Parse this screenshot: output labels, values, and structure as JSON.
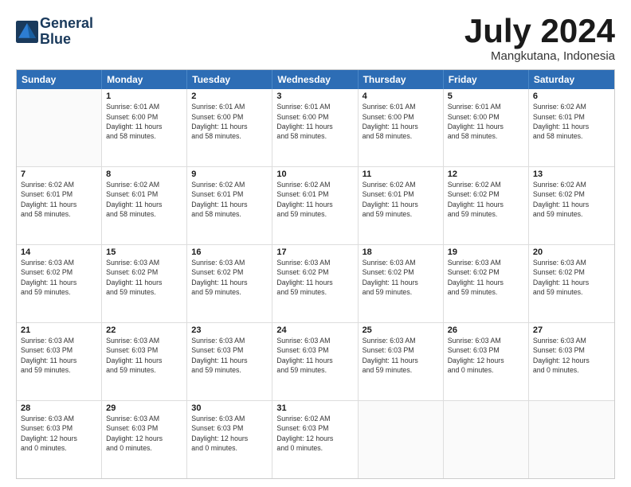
{
  "logo": {
    "line1": "General",
    "line2": "Blue"
  },
  "title": "July 2024",
  "location": "Mangkutana, Indonesia",
  "days_of_week": [
    "Sunday",
    "Monday",
    "Tuesday",
    "Wednesday",
    "Thursday",
    "Friday",
    "Saturday"
  ],
  "weeks": [
    [
      {
        "day": "",
        "info": ""
      },
      {
        "day": "1",
        "info": "Sunrise: 6:01 AM\nSunset: 6:00 PM\nDaylight: 11 hours\nand 58 minutes."
      },
      {
        "day": "2",
        "info": "Sunrise: 6:01 AM\nSunset: 6:00 PM\nDaylight: 11 hours\nand 58 minutes."
      },
      {
        "day": "3",
        "info": "Sunrise: 6:01 AM\nSunset: 6:00 PM\nDaylight: 11 hours\nand 58 minutes."
      },
      {
        "day": "4",
        "info": "Sunrise: 6:01 AM\nSunset: 6:00 PM\nDaylight: 11 hours\nand 58 minutes."
      },
      {
        "day": "5",
        "info": "Sunrise: 6:01 AM\nSunset: 6:00 PM\nDaylight: 11 hours\nand 58 minutes."
      },
      {
        "day": "6",
        "info": "Sunrise: 6:02 AM\nSunset: 6:01 PM\nDaylight: 11 hours\nand 58 minutes."
      }
    ],
    [
      {
        "day": "7",
        "info": "Sunrise: 6:02 AM\nSunset: 6:01 PM\nDaylight: 11 hours\nand 58 minutes."
      },
      {
        "day": "8",
        "info": "Sunrise: 6:02 AM\nSunset: 6:01 PM\nDaylight: 11 hours\nand 58 minutes."
      },
      {
        "day": "9",
        "info": "Sunrise: 6:02 AM\nSunset: 6:01 PM\nDaylight: 11 hours\nand 58 minutes."
      },
      {
        "day": "10",
        "info": "Sunrise: 6:02 AM\nSunset: 6:01 PM\nDaylight: 11 hours\nand 59 minutes."
      },
      {
        "day": "11",
        "info": "Sunrise: 6:02 AM\nSunset: 6:01 PM\nDaylight: 11 hours\nand 59 minutes."
      },
      {
        "day": "12",
        "info": "Sunrise: 6:02 AM\nSunset: 6:02 PM\nDaylight: 11 hours\nand 59 minutes."
      },
      {
        "day": "13",
        "info": "Sunrise: 6:02 AM\nSunset: 6:02 PM\nDaylight: 11 hours\nand 59 minutes."
      }
    ],
    [
      {
        "day": "14",
        "info": "Sunrise: 6:03 AM\nSunset: 6:02 PM\nDaylight: 11 hours\nand 59 minutes."
      },
      {
        "day": "15",
        "info": "Sunrise: 6:03 AM\nSunset: 6:02 PM\nDaylight: 11 hours\nand 59 minutes."
      },
      {
        "day": "16",
        "info": "Sunrise: 6:03 AM\nSunset: 6:02 PM\nDaylight: 11 hours\nand 59 minutes."
      },
      {
        "day": "17",
        "info": "Sunrise: 6:03 AM\nSunset: 6:02 PM\nDaylight: 11 hours\nand 59 minutes."
      },
      {
        "day": "18",
        "info": "Sunrise: 6:03 AM\nSunset: 6:02 PM\nDaylight: 11 hours\nand 59 minutes."
      },
      {
        "day": "19",
        "info": "Sunrise: 6:03 AM\nSunset: 6:02 PM\nDaylight: 11 hours\nand 59 minutes."
      },
      {
        "day": "20",
        "info": "Sunrise: 6:03 AM\nSunset: 6:02 PM\nDaylight: 11 hours\nand 59 minutes."
      }
    ],
    [
      {
        "day": "21",
        "info": "Sunrise: 6:03 AM\nSunset: 6:03 PM\nDaylight: 11 hours\nand 59 minutes."
      },
      {
        "day": "22",
        "info": "Sunrise: 6:03 AM\nSunset: 6:03 PM\nDaylight: 11 hours\nand 59 minutes."
      },
      {
        "day": "23",
        "info": "Sunrise: 6:03 AM\nSunset: 6:03 PM\nDaylight: 11 hours\nand 59 minutes."
      },
      {
        "day": "24",
        "info": "Sunrise: 6:03 AM\nSunset: 6:03 PM\nDaylight: 11 hours\nand 59 minutes."
      },
      {
        "day": "25",
        "info": "Sunrise: 6:03 AM\nSunset: 6:03 PM\nDaylight: 11 hours\nand 59 minutes."
      },
      {
        "day": "26",
        "info": "Sunrise: 6:03 AM\nSunset: 6:03 PM\nDaylight: 12 hours\nand 0 minutes."
      },
      {
        "day": "27",
        "info": "Sunrise: 6:03 AM\nSunset: 6:03 PM\nDaylight: 12 hours\nand 0 minutes."
      }
    ],
    [
      {
        "day": "28",
        "info": "Sunrise: 6:03 AM\nSunset: 6:03 PM\nDaylight: 12 hours\nand 0 minutes."
      },
      {
        "day": "29",
        "info": "Sunrise: 6:03 AM\nSunset: 6:03 PM\nDaylight: 12 hours\nand 0 minutes."
      },
      {
        "day": "30",
        "info": "Sunrise: 6:03 AM\nSunset: 6:03 PM\nDaylight: 12 hours\nand 0 minutes."
      },
      {
        "day": "31",
        "info": "Sunrise: 6:02 AM\nSunset: 6:03 PM\nDaylight: 12 hours\nand 0 minutes."
      },
      {
        "day": "",
        "info": ""
      },
      {
        "day": "",
        "info": ""
      },
      {
        "day": "",
        "info": ""
      }
    ]
  ]
}
